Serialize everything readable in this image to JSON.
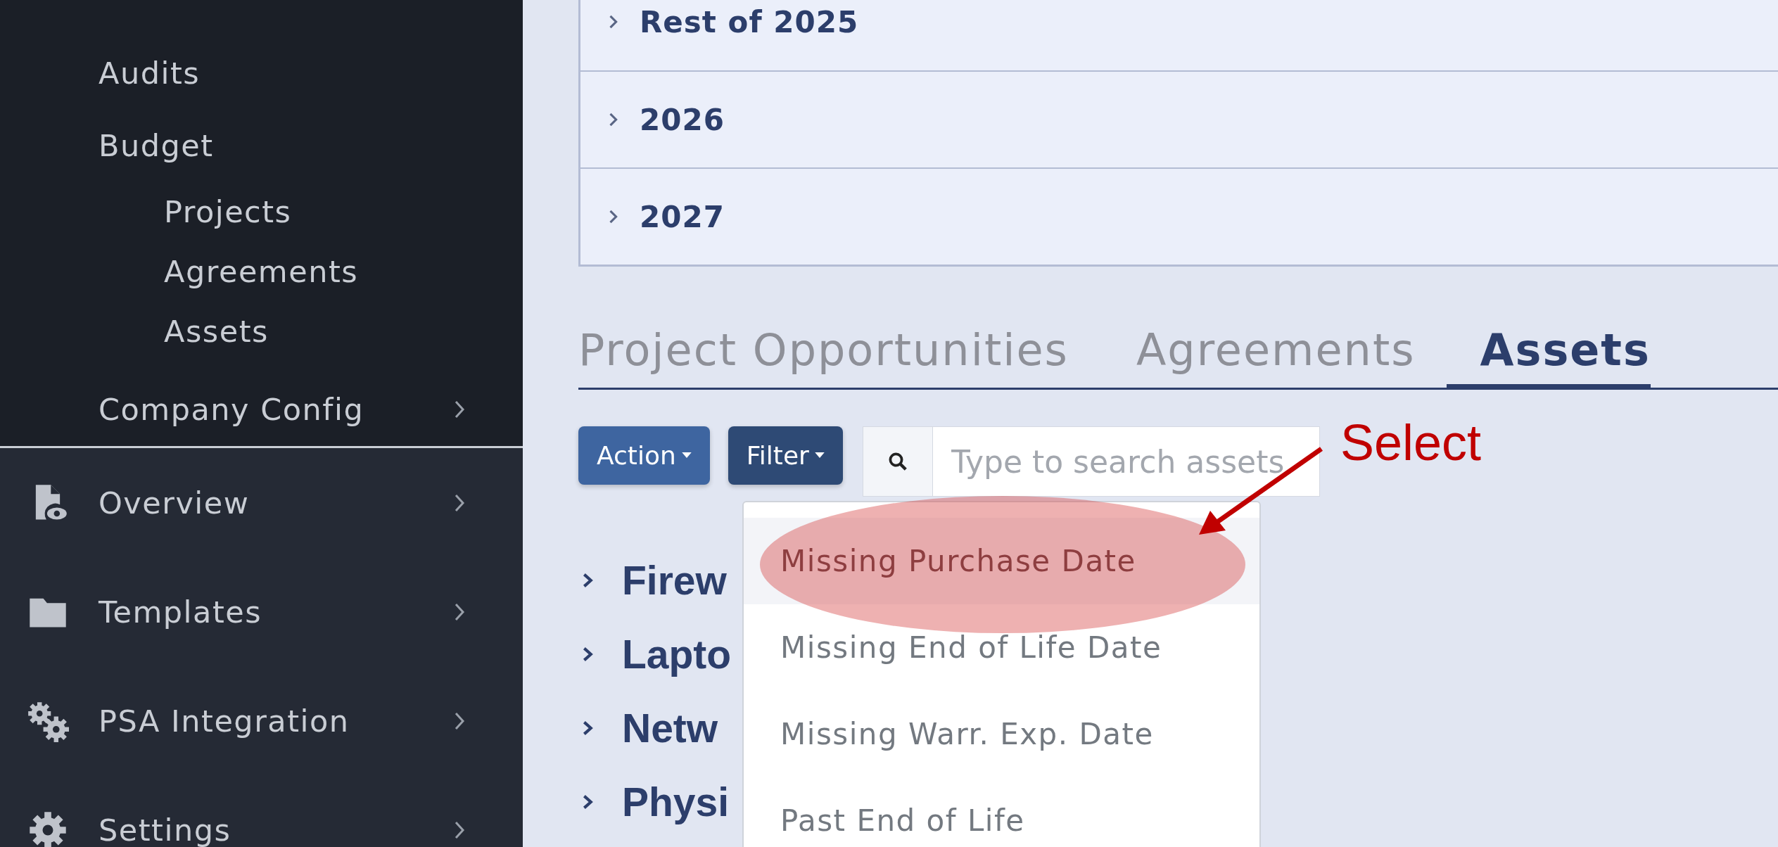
{
  "sidebar": {
    "menu": [
      {
        "label": "Audits",
        "expandable": false
      },
      {
        "label": "Budget",
        "expandable": false,
        "children": [
          {
            "label": "Projects"
          },
          {
            "label": "Agreements"
          },
          {
            "label": "Assets"
          }
        ]
      },
      {
        "label": "Company Config",
        "expandable": true
      }
    ],
    "sections": [
      {
        "label": "Overview",
        "expandable": true
      },
      {
        "label": "Templates",
        "expandable": true
      },
      {
        "label": "PSA Integration",
        "expandable": true
      },
      {
        "label": "Settings",
        "expandable": true
      }
    ]
  },
  "budget_rows": [
    {
      "label": "Rest of 2025",
      "expanded": false
    },
    {
      "label": "2026",
      "expanded": false
    },
    {
      "label": "2027",
      "expanded": false
    }
  ],
  "tabs": [
    {
      "label": "Project Opportunities",
      "selected": false
    },
    {
      "label": "Agreements",
      "selected": false
    },
    {
      "label": "Assets",
      "selected": true
    }
  ],
  "toolbar": {
    "buttons": [
      "Action",
      "Filter"
    ],
    "search": {
      "placeholder": "Type to search assets"
    }
  },
  "asset_groups": [
    {
      "label": "Firew",
      "expanded": false
    },
    {
      "label": "Lapto",
      "expanded": false
    },
    {
      "label": "Netw",
      "expanded": false
    },
    {
      "label": "Physi",
      "expanded": false
    }
  ],
  "filter_menu": {
    "items": [
      {
        "label": "Missing Purchase Date",
        "selected": true
      },
      {
        "label": "Missing End of Life Date",
        "selected": false
      },
      {
        "label": "Missing Warr. Exp. Date",
        "selected": false
      },
      {
        "label": "Past End of Life",
        "selected": false
      }
    ]
  },
  "annotation": {
    "label": "Select"
  }
}
